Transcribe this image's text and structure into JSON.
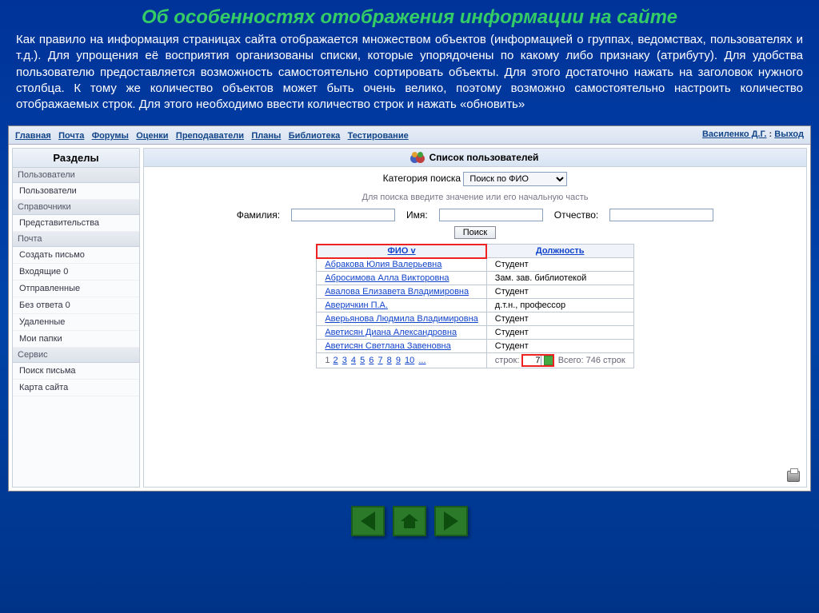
{
  "slide": {
    "title": "Об особенностях отображения информации на сайте",
    "body": "Как правило на информация страницах сайта отображается множеством объектов (информацией о группах, ведомствах, пользователях и т.д.). Для упрощения её восприятия организованы списки, которые упорядочены по какому либо признаку (атрибуту). Для удобства пользователю предоставляется возможность самостоятельно сортировать объекты. Для этого достаточно нажать на заголовок нужного столбца. К тому же количество объектов может быть очень велико, поэтому возможно самостоятельно настроить количество отображаемых строк. Для этого необходимо ввести количество строк и нажать «обновить»"
  },
  "topnav": {
    "items": [
      "Главная",
      "Почта",
      "Форумы",
      "Оценки",
      "Преподаватели",
      "Планы",
      "Библиотека",
      "Тестирование"
    ],
    "user": "Василенко Д.Г.",
    "sep": " : ",
    "logout": "Выход"
  },
  "sidebar": {
    "title": "Разделы",
    "groups": [
      {
        "label": "Пользователи",
        "items": [
          "Пользователи"
        ]
      },
      {
        "label": "Справочники",
        "items": [
          "Представительства"
        ]
      },
      {
        "label": "Почта",
        "items": [
          "Создать письмо",
          "Входящие 0",
          "Отправленные",
          "Без ответа 0",
          "Удаленные",
          "Мои папки"
        ]
      },
      {
        "label": "Сервис",
        "items": [
          "Поиск письма",
          "Карта сайта"
        ]
      }
    ]
  },
  "main": {
    "title": "Список пользователей",
    "category_label": "Категория поиска",
    "category_value": "Поиск по ФИО",
    "hint": "Для поиска введите значение или его начальную часть",
    "f_surname": "Фамилия:",
    "f_name": "Имя:",
    "f_patronymic": "Отчество:",
    "search_btn": "Поиск",
    "col_fio": "ФИО v",
    "col_pos": "Должность",
    "rows": [
      {
        "fio": "Абракова Юлия Валерьевна",
        "pos": "Студент"
      },
      {
        "fio": "Абросимова Алла Викторовна",
        "pos": "Зам. зав. библиотекой"
      },
      {
        "fio": "Авалова Елизавета Владимировна",
        "pos": "Студент"
      },
      {
        "fio": "Аверичкин П.А.",
        "pos": "д.т.н., профессор"
      },
      {
        "fio": "Аверьянова Людмила Владимировна",
        "pos": "Студент"
      },
      {
        "fio": "Аветисян Диана Александровна",
        "pos": "Студент"
      },
      {
        "fio": "Аветисян Светлана Завеновна",
        "pos": "Студент"
      }
    ],
    "pager": {
      "current": "1",
      "pages": [
        "2",
        "3",
        "4",
        "5",
        "6",
        "7",
        "8",
        "9",
        "10",
        "..."
      ],
      "rows_label": "строк:",
      "rows_value": "7",
      "total": "Всего: 746 строк"
    }
  }
}
